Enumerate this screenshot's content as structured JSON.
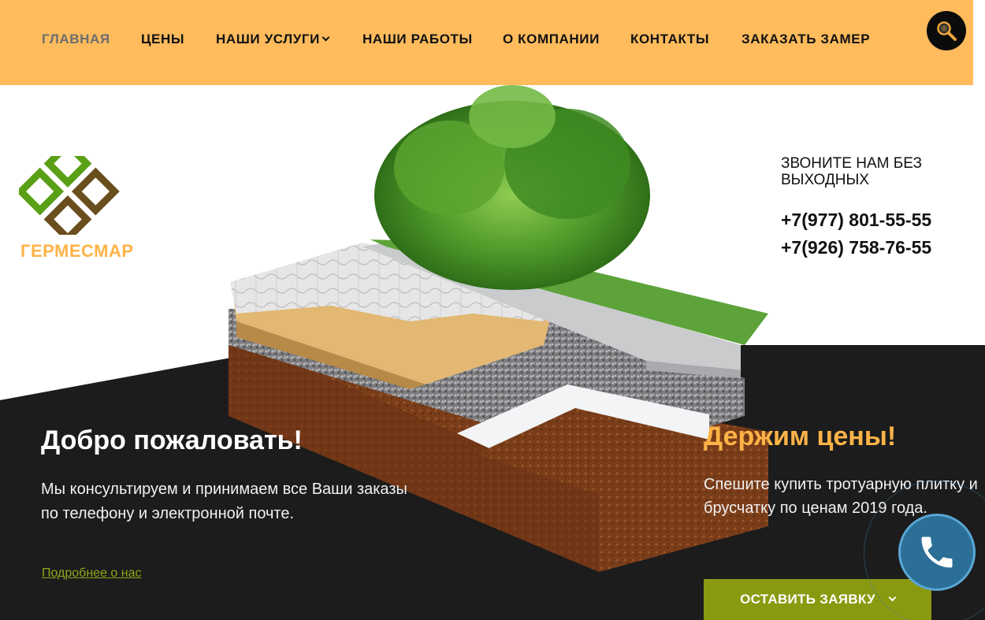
{
  "nav": {
    "items": [
      {
        "label": "ГЛАВНАЯ",
        "active": true
      },
      {
        "label": "ЦЕНЫ"
      },
      {
        "label": "НАШИ УСЛУГИ",
        "dropdown": true
      },
      {
        "label": "НАШИ РАБОТЫ"
      },
      {
        "label": "О КОМПАНИИ"
      },
      {
        "label": "КОНТАКТЫ"
      },
      {
        "label": "ЗАКАЗАТЬ ЗАМЕР"
      }
    ],
    "search_icon": "search-icon"
  },
  "logo": {
    "text": "ГЕРМЕСМАР"
  },
  "contacts": {
    "title": "ЗВОНИТЕ НАМ БЕЗ ВЫХОДНЫХ",
    "phone1": "+7(977) 801-55-55",
    "phone2": "+7(926) 758-76-55"
  },
  "welcome": {
    "title": "Добро пожаловать!",
    "text": "Мы консультируем и принимаем  все Ваши заказы по телефону и электронной почте.",
    "link": "Подробнее о нас"
  },
  "promo": {
    "title": "Держим цены!",
    "text_line1": "Спешите купить тротуарную плитку и",
    "text_line2": "брусчатку по ценам 2019 года."
  },
  "order_button": {
    "label": "ОСТАВИТЬ ЗАЯВКУ"
  },
  "colors": {
    "header_bg": "#ffbb5c",
    "accent_orange": "#ffb347",
    "button_green": "#8a9a10",
    "link_green": "#8ea61b",
    "dark_bg": "#1c1c1c",
    "call_blue": "#2b6f97"
  }
}
